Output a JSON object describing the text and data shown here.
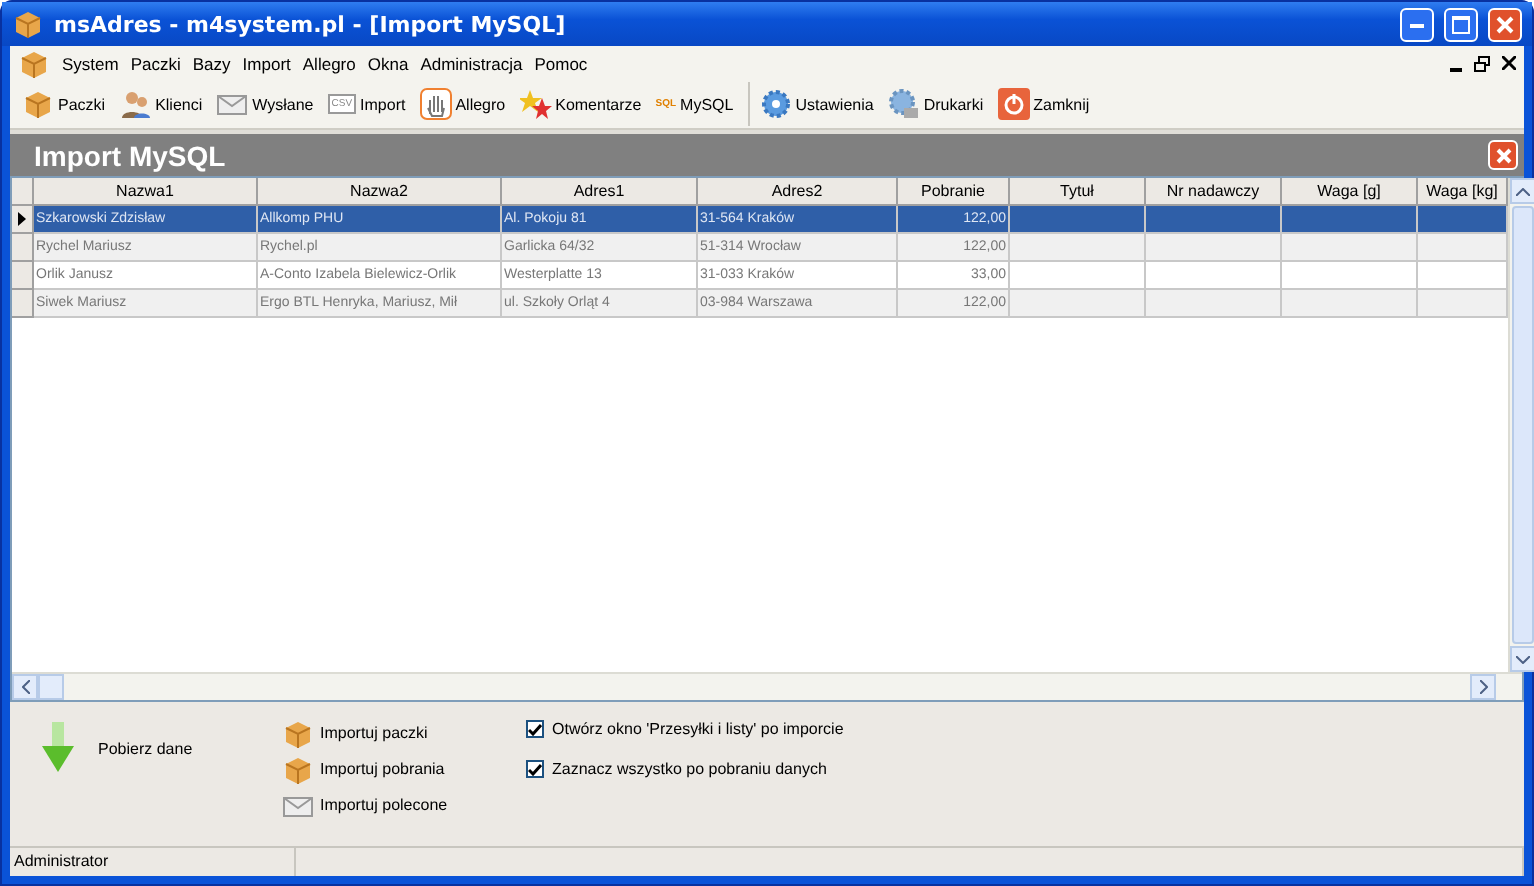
{
  "window": {
    "title": "msAdres - m4system.pl - [Import MySQL]"
  },
  "menu": [
    "System",
    "Paczki",
    "Bazy",
    "Import",
    "Allegro",
    "Okna",
    "Administracja",
    "Pomoc"
  ],
  "toolbar": [
    {
      "kind": "box",
      "label": "Paczki"
    },
    {
      "kind": "people",
      "label": "Klienci"
    },
    {
      "kind": "mail",
      "label": "Wysłane"
    },
    {
      "kind": "csv",
      "label": "Import",
      "icon_text": "CSV"
    },
    {
      "kind": "hand",
      "label": "Allegro"
    },
    {
      "kind": "stars",
      "label": "Komentarze"
    },
    {
      "kind": "sql",
      "label": "MySQL",
      "icon_text": "SQL"
    },
    {
      "kind": "gear",
      "label": "Ustawienia",
      "group_start": true
    },
    {
      "kind": "printer",
      "label": "Drukarki"
    },
    {
      "kind": "power",
      "label": "Zamknij"
    }
  ],
  "panel": {
    "title": "Import MySQL"
  },
  "table": {
    "columns": [
      "Nazwa1",
      "Nazwa2",
      "Adres1",
      "Adres2",
      "Pobranie",
      "Tytuł",
      "Nr nadawczy",
      "Waga [g]",
      "Waga [kg]"
    ],
    "rows": [
      {
        "selected": true,
        "cells": [
          "Szkarowski Zdzisław",
          "Allkomp PHU",
          "Al. Pokoju 81",
          "31-564 Kraków",
          "122,00",
          "",
          "",
          "",
          ""
        ]
      },
      {
        "selected": false,
        "cells": [
          "Rychel Mariusz",
          "Rychel.pl",
          "Garlicka 64/32",
          "51-314 Wrocław",
          "122,00",
          "",
          "",
          "",
          ""
        ]
      },
      {
        "selected": false,
        "cells": [
          "Orlik Janusz",
          "A-Conto Izabela Bielewicz-Orlik",
          "Westerplatte 13",
          "31-033 Kraków",
          "33,00",
          "",
          "",
          "",
          ""
        ]
      },
      {
        "selected": false,
        "cells": [
          "Siwek Mariusz",
          "Ergo BTL Henryka, Mariusz, Mił",
          "ul. Szkoły Orląt 4",
          "03-984 Warszawa",
          "122,00",
          "",
          "",
          "",
          ""
        ]
      }
    ]
  },
  "actions": {
    "fetch": "Pobierz dane",
    "imports": [
      {
        "kind": "box",
        "label": "Importuj paczki"
      },
      {
        "kind": "box",
        "label": "Importuj pobrania"
      },
      {
        "kind": "mail",
        "label": "Importuj polecone"
      }
    ],
    "options": [
      {
        "label": "Otwórz okno 'Przesyłki i listy' po imporcie",
        "checked": true
      },
      {
        "label": "Zaznacz wszystko po pobraniu danych",
        "checked": true
      }
    ]
  },
  "status_bar": [
    "Administrator"
  ]
}
